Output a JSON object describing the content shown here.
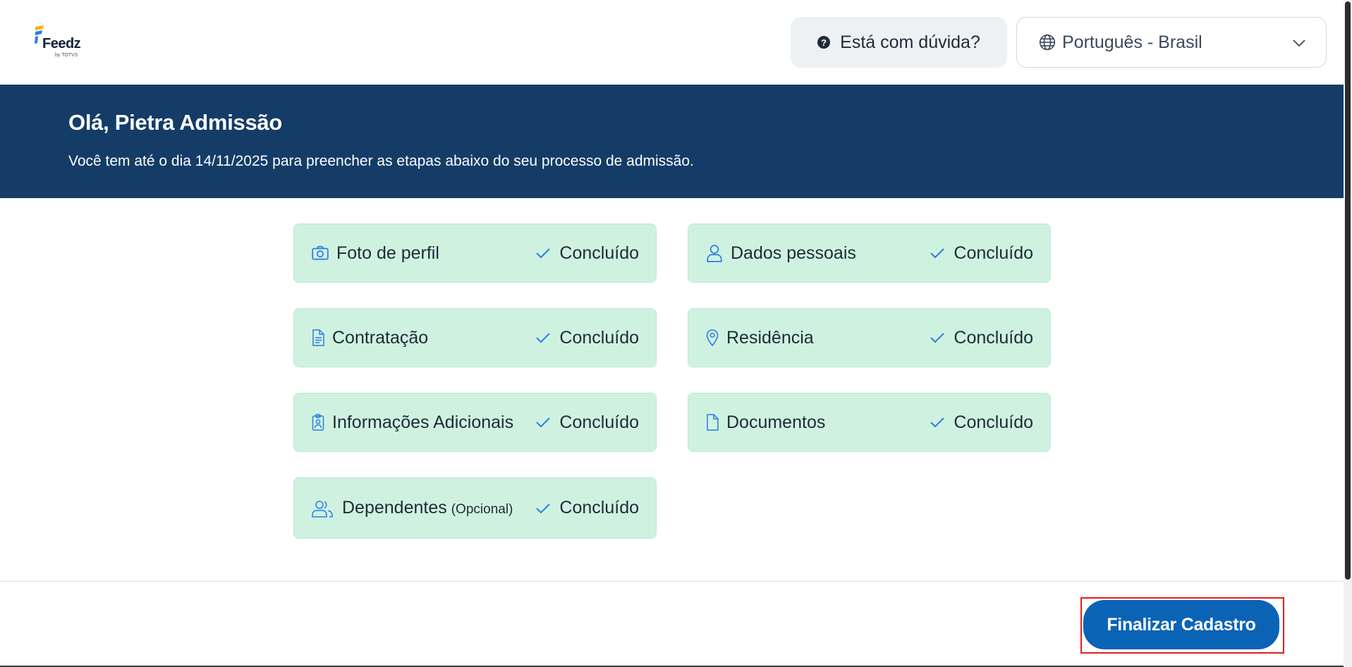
{
  "header": {
    "logo_text": "Feedz",
    "logo_sub": "by TOTVS",
    "help_label": "Está com dúvida?",
    "language_selected": "Português - Brasil"
  },
  "banner": {
    "greeting": "Olá, Pietra Admissão",
    "message": "Você tem até o dia 14/11/2025 para preencher as etapas abaixo do seu processo de admissão."
  },
  "steps": [
    {
      "label": "Foto de perfil",
      "optional": "",
      "status": "Concluído",
      "icon": "camera-icon"
    },
    {
      "label": "Dados pessoais",
      "optional": "",
      "status": "Concluído",
      "icon": "user-icon"
    },
    {
      "label": "Contratação",
      "optional": "",
      "status": "Concluído",
      "icon": "document-lines-icon"
    },
    {
      "label": "Residência",
      "optional": "",
      "status": "Concluído",
      "icon": "map-pin-icon"
    },
    {
      "label": "Informações Adicionais",
      "optional": "",
      "status": "Concluído",
      "icon": "id-badge-icon"
    },
    {
      "label": "Documentos",
      "optional": "",
      "status": "Concluído",
      "icon": "file-icon"
    },
    {
      "label": "Dependentes",
      "optional": "(Opcional)",
      "status": "Concluído",
      "icon": "users-icon"
    }
  ],
  "footer": {
    "finish_label": "Finalizar Cadastro"
  },
  "colors": {
    "banner_bg": "#143c67",
    "card_bg": "#cff2e0",
    "accent_blue": "#0b63b5",
    "icon_blue": "#2d7be5",
    "highlight_red": "#e11d1d"
  }
}
